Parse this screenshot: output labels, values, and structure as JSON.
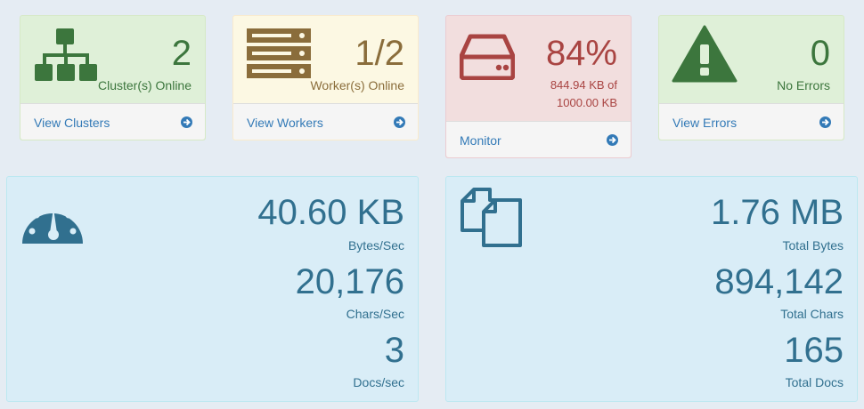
{
  "colors": {
    "success_bg": "#dff0d8",
    "warning_bg": "#fcf8e3",
    "danger_bg": "#f2dede",
    "info_bg": "#d9edf7",
    "link": "#337ab7"
  },
  "cards": {
    "clusters": {
      "value": "2",
      "label": "Cluster(s) Online",
      "link": "View Clusters",
      "icon": "sitemap-icon"
    },
    "workers": {
      "value": "1/2",
      "label": "Worker(s) Online",
      "link": "View Workers",
      "icon": "server-icon"
    },
    "memory": {
      "value": "84%",
      "detail_line1": "844.94 KB of",
      "detail_line2": "1000.00 KB",
      "link": "Monitor",
      "icon": "hdd-icon"
    },
    "errors": {
      "value": "0",
      "label": "No Errors",
      "link": "View Errors",
      "icon": "warning-icon"
    }
  },
  "throughput": {
    "icon": "dashboard-icon",
    "bytes_value": "40.60 KB",
    "bytes_label": "Bytes/Sec",
    "chars_value": "20,176",
    "chars_label": "Chars/Sec",
    "docs_value": "3",
    "docs_label": "Docs/sec"
  },
  "totals": {
    "icon": "files-icon",
    "bytes_value": "1.76 MB",
    "bytes_label": "Total Bytes",
    "chars_value": "894,142",
    "chars_label": "Total Chars",
    "docs_value": "165",
    "docs_label": "Total Docs"
  }
}
